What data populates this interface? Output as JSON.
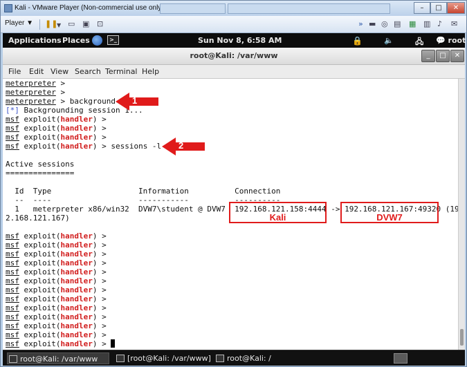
{
  "vm": {
    "title": "Kali - VMware Player (Non-commercial use only)",
    "player_menu": "Player ▼",
    "min": "–",
    "max": "□",
    "close": "✕"
  },
  "panel": {
    "applications": "Applications",
    "places": "Places",
    "clock": "Sun Nov  8,  6:58 AM",
    "user": "root"
  },
  "terminal": {
    "title": "root@Kali: /var/www",
    "menu": [
      "File",
      "Edit",
      "View",
      "Search",
      "Terminal",
      "Help"
    ],
    "lines": {
      "l1": "meterpreter",
      "l1b": " >",
      "l3cmd": " > background",
      "info_prefix": "[*]",
      "info_text": " Backgrounding session 1...",
      "msf": "msf",
      "exploit": " exploit(",
      "handler": "handler",
      "close_prompt": ") >",
      "sessions_cmd": ") > sessions -l",
      "active_sessions": "Active sessions",
      "equals_rule": "===============",
      "header": "  Id  Type                   Information          Connection",
      "dashes": "  --  ----                   -----------          ----------",
      "row_a": "  1   meterpreter x86/win32  DVW7\\student @ DVW7  192.168.121.158:4444 -> 192.168.121.167:49320 (19",
      "row_b": "2.168.121.167)"
    }
  },
  "annotations": {
    "arrow1": "1",
    "arrow2": "2",
    "box1_label": "Kali",
    "box2_label": "DVW7"
  },
  "taskbar": {
    "items": [
      "root@Kali: /var/www",
      "[root@Kali: /var/www]",
      "root@Kali: /"
    ]
  }
}
